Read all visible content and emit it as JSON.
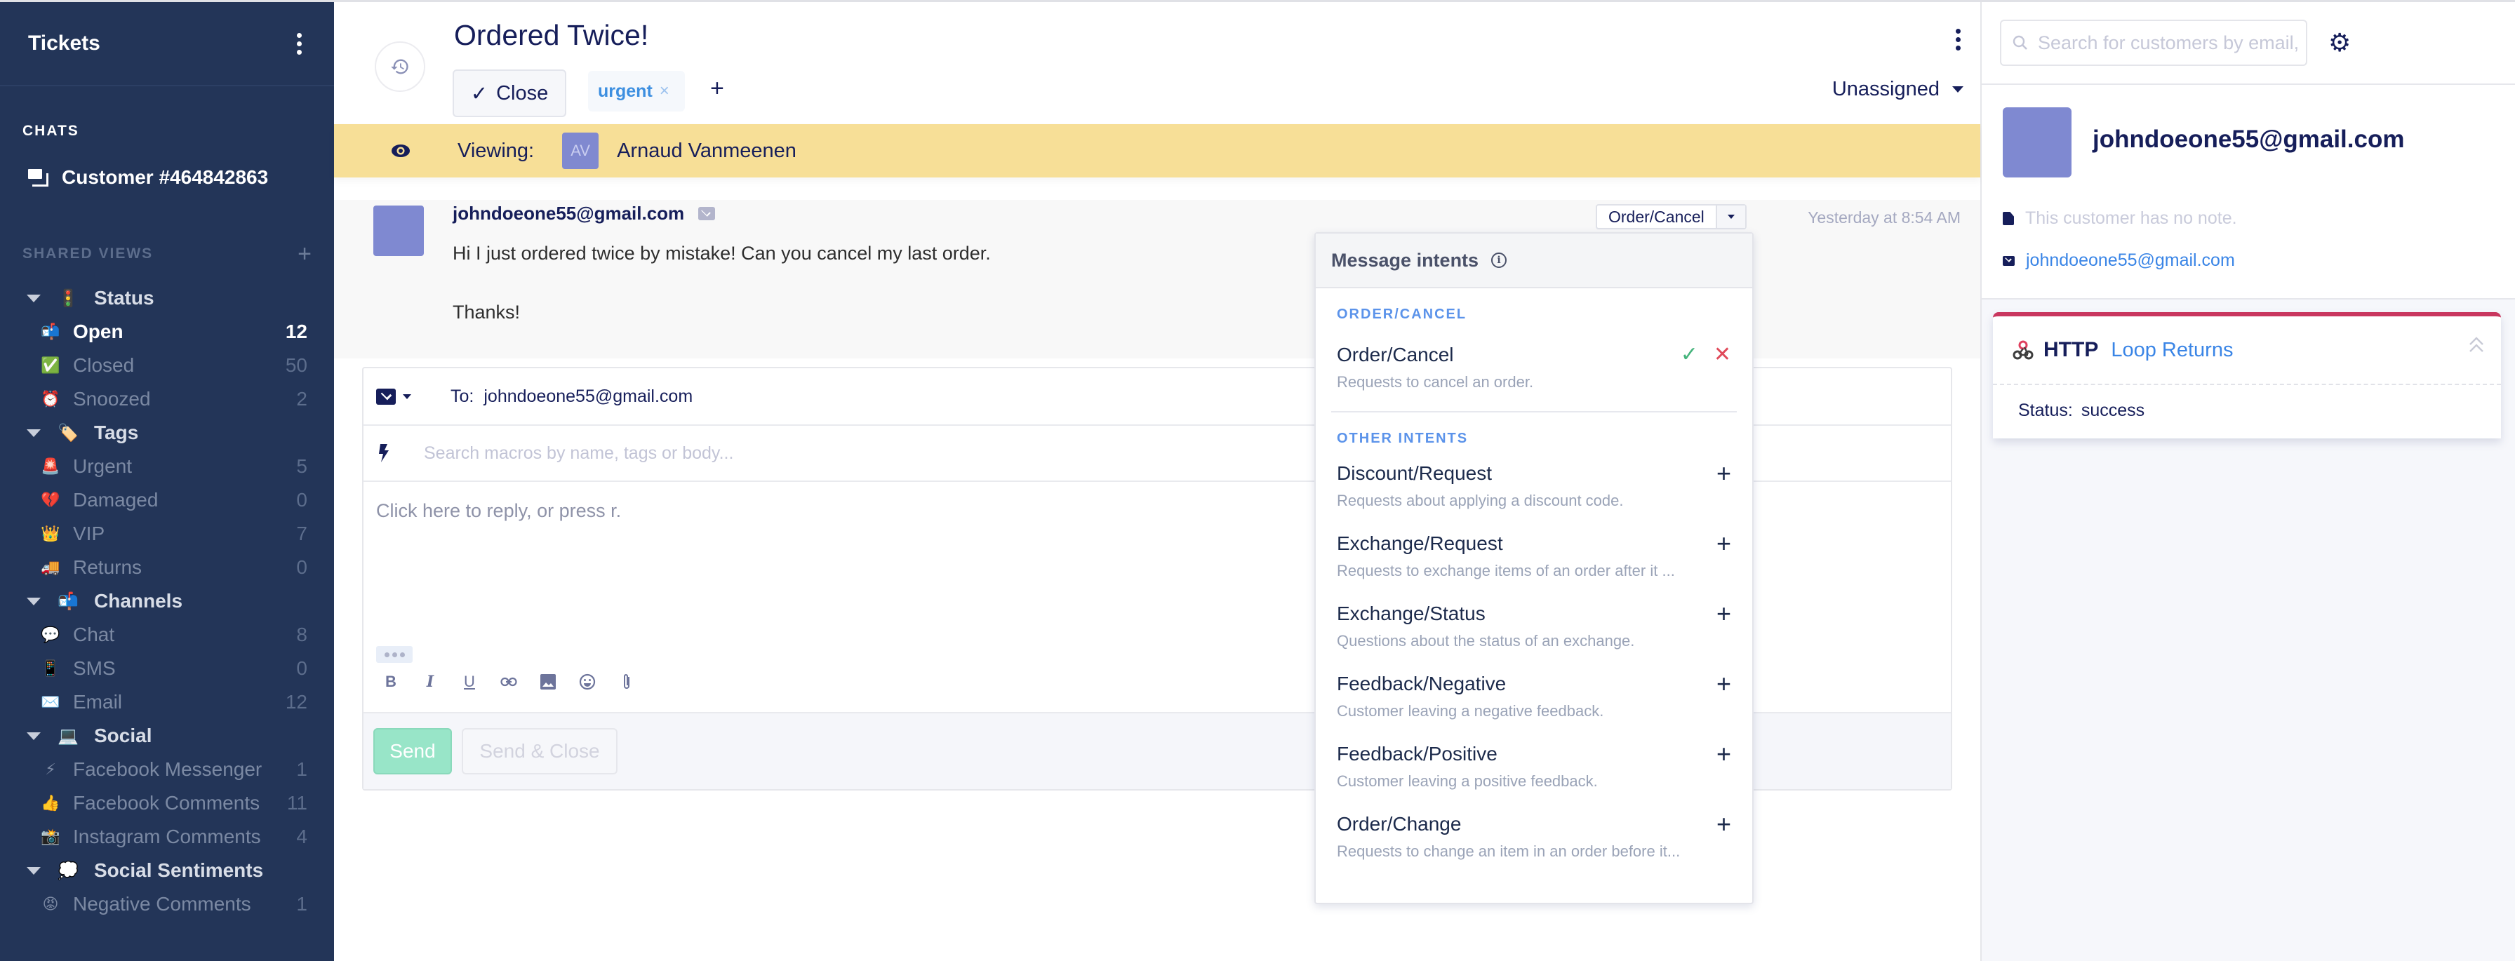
{
  "sidebar": {
    "title": "Tickets",
    "chats_label": "CHATS",
    "chat_item": "Customer #464842863",
    "shared_views_label": "SHARED VIEWS",
    "groups": [
      {
        "label": "Status",
        "emoji": "🚦",
        "items": [
          {
            "label": "Open",
            "emoji": "📬",
            "count": "12",
            "active": true
          },
          {
            "label": "Closed",
            "emoji": "✅",
            "count": "50"
          },
          {
            "label": "Snoozed",
            "emoji": "⏰",
            "count": "2"
          }
        ]
      },
      {
        "label": "Tags",
        "emoji": "🏷️",
        "items": [
          {
            "label": "Urgent",
            "emoji": "🚨",
            "count": "5"
          },
          {
            "label": "Damaged",
            "emoji": "💔",
            "count": "0"
          },
          {
            "label": "VIP",
            "emoji": "👑",
            "count": "7"
          },
          {
            "label": "Returns",
            "emoji": "🚚",
            "count": "0"
          }
        ]
      },
      {
        "label": "Channels",
        "emoji": "📬",
        "items": [
          {
            "label": "Chat",
            "emoji": "💬",
            "count": "8"
          },
          {
            "label": "SMS",
            "emoji": "📱",
            "count": "0"
          },
          {
            "label": "Email",
            "emoji": "✉️",
            "count": "12"
          }
        ]
      },
      {
        "label": "Social",
        "emoji": "💻",
        "items": [
          {
            "label": "Facebook Messenger",
            "emoji": "⚡",
            "count": "1"
          },
          {
            "label": "Facebook Comments",
            "emoji": "👍",
            "count": "11"
          },
          {
            "label": "Instagram Comments",
            "emoji": "📸",
            "count": "4"
          }
        ]
      },
      {
        "label": "Social Sentiments",
        "emoji": "💭",
        "items": [
          {
            "label": "Negative Comments",
            "emoji": "😡",
            "count": "1"
          }
        ]
      }
    ]
  },
  "ticket": {
    "title": "Ordered Twice!",
    "close_label": "Close",
    "tag": "urgent",
    "assignee": "Unassigned",
    "viewing_label": "Viewing:",
    "viewer_initials": "AV",
    "viewer_name": "Arnaud Vanmeenen"
  },
  "message": {
    "from": "johndoeone55@gmail.com",
    "body": [
      "Hi I just ordered twice by mistake! Can you cancel my last order.",
      "Thanks!"
    ],
    "intent": "Order/Cancel",
    "time": "Yesterday at 8:54 AM"
  },
  "composer": {
    "to_label": "To:",
    "to_value": "johndoeone55@gmail.com",
    "macro_placeholder": "Search macros by name, tags or body...",
    "reply_placeholder": "Click here to reply, or press r.",
    "send_label": "Send",
    "send_close_label": "Send & Close"
  },
  "intents": {
    "title": "Message intents",
    "current_section": "ORDER/CANCEL",
    "current": {
      "name": "Order/Cancel",
      "desc": "Requests to cancel an order."
    },
    "other_section": "OTHER INTENTS",
    "others": [
      {
        "name": "Discount/Request",
        "desc": "Requests about applying a discount code."
      },
      {
        "name": "Exchange/Request",
        "desc": "Requests to exchange items of an order after it ..."
      },
      {
        "name": "Exchange/Status",
        "desc": "Questions about the status of an exchange."
      },
      {
        "name": "Feedback/Negative",
        "desc": "Customer leaving a negative feedback."
      },
      {
        "name": "Feedback/Positive",
        "desc": "Customer leaving a positive feedback."
      },
      {
        "name": "Order/Change",
        "desc": "Requests to change an item in an order before it..."
      }
    ]
  },
  "customer_panel": {
    "search_placeholder": "Search for customers by email, order number",
    "name": "johndoeone55@gmail.com",
    "note": "This customer has no note.",
    "email": "johndoeone55@gmail.com",
    "http": {
      "title": "HTTP",
      "integration": "Loop Returns",
      "status_label": "Status:",
      "status_value": "success"
    }
  },
  "colors": {
    "sidebar_bg": "#233558",
    "accent_blue": "#3a85e6",
    "viewing_bar": "#f7df97",
    "send_green": "#98e5c8",
    "http_red": "#c9375f"
  }
}
